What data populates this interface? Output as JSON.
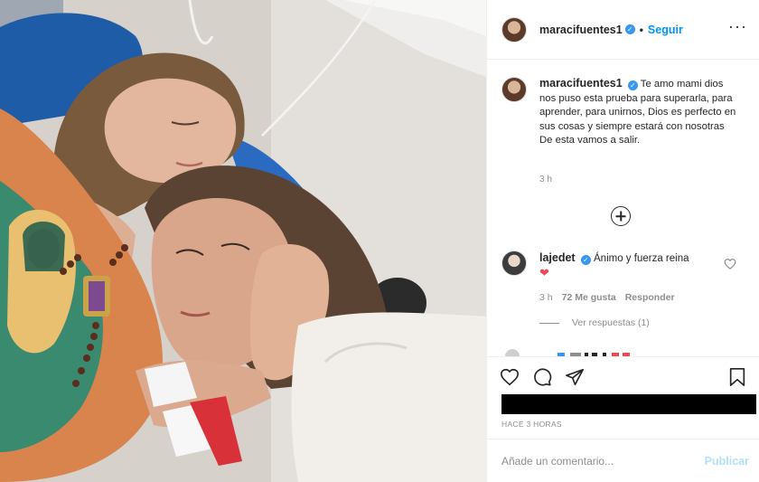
{
  "post": {
    "photo_alt": "",
    "username": "maracifuentes1",
    "follow_label": "Seguir",
    "separator": "•",
    "more_icon": "more-options-icon",
    "verified_icon": "verified-badge-icon"
  },
  "caption": {
    "username": "maracifuentes1",
    "text": "Te amo mami dios nos puso esta prueba para superarla, para aprender, para unirnos, Dios es perfecto en sus cosas y siempre estará con nosotras",
    "text_line2": "De esta vamos a salir.",
    "time": "3 h"
  },
  "comment": {
    "username": "lajedet",
    "text": "Ánimo y fuerza reina",
    "emoji": "❤",
    "time": "3 h",
    "likes": "72 Me gusta",
    "reply_label": "Responder",
    "view_replies": "Ver respuestas (1)"
  },
  "actions": {
    "like_icon": "heart-outline-icon",
    "comment_icon": "comment-icon",
    "share_icon": "share-icon",
    "save_icon": "bookmark-icon"
  },
  "meta": {
    "timeago": "HACE 3 HORAS"
  },
  "add_comment": {
    "placeholder": "Añade un comentario...",
    "publish_label": "Publicar"
  },
  "colors": {
    "accent": "#0095f6",
    "verified": "#3897f0",
    "heart": "#ed4956",
    "publish_disabled": "#b2dffc"
  }
}
